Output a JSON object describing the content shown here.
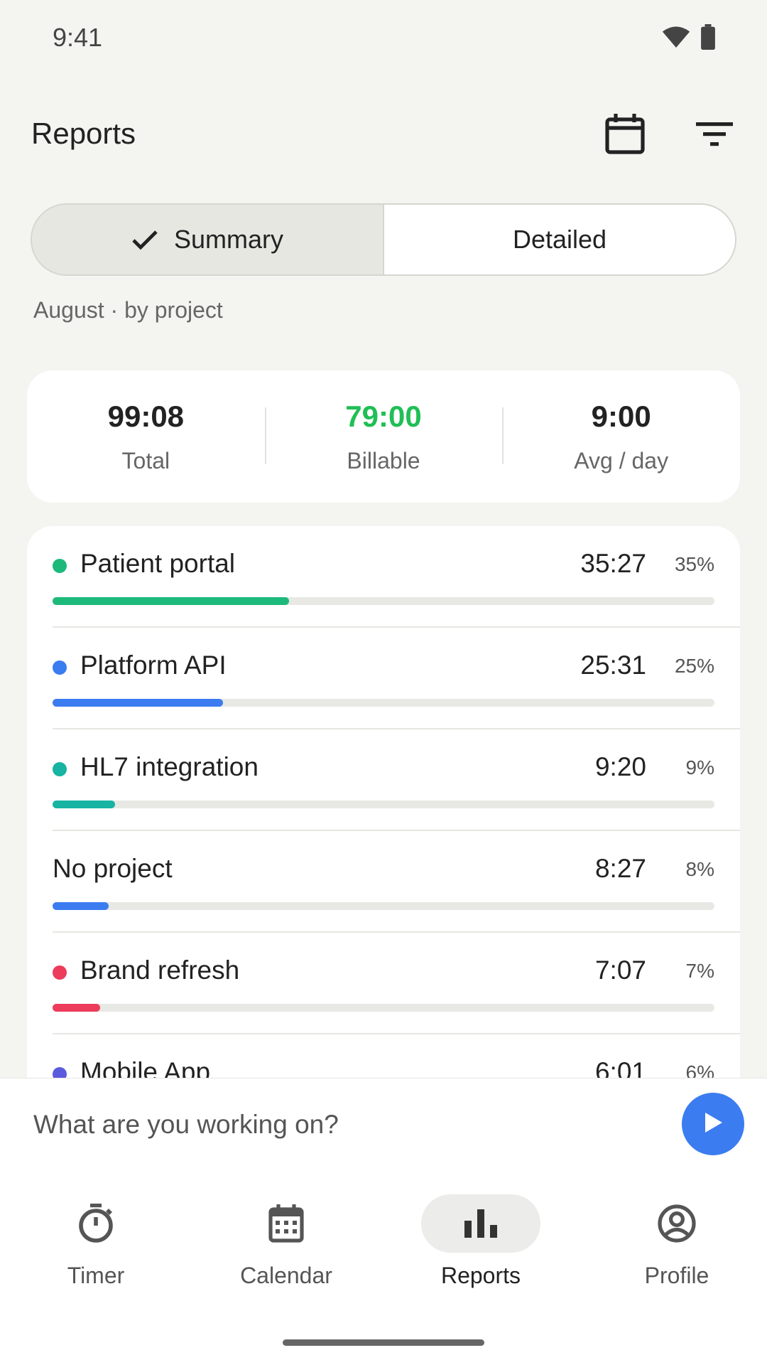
{
  "status": {
    "time": "9:41"
  },
  "header": {
    "title": "Reports"
  },
  "segmented": {
    "summary": "Summary",
    "detailed": "Detailed"
  },
  "subtitle": "August · by project",
  "totals": [
    {
      "value": "99:08",
      "label": "Total"
    },
    {
      "value": "79:00",
      "label": "Billable"
    },
    {
      "value": "9:00",
      "label": "Avg / day"
    }
  ],
  "projects": [
    {
      "name": "Patient portal",
      "duration": "35:27",
      "percent": "35%",
      "fraction": 0.357,
      "color": "#1db97a"
    },
    {
      "name": "Platform API",
      "duration": "25:31",
      "percent": "25%",
      "fraction": 0.257,
      "color": "#3b7cf0"
    },
    {
      "name": "HL7 integration",
      "duration": "9:20",
      "percent": "9%",
      "fraction": 0.094,
      "color": "#17b3a3"
    },
    {
      "name": "No project",
      "duration": "8:27",
      "percent": "8%",
      "fraction": 0.085,
      "color": "#3b7cf0",
      "nodot": true
    },
    {
      "name": "Brand refresh",
      "duration": "7:07",
      "percent": "7%",
      "fraction": 0.072,
      "color": "#ec3b5b"
    },
    {
      "name": "Mobile App",
      "duration": "6:01",
      "percent": "6%",
      "fraction": 0.06,
      "color": "#5b5bde"
    }
  ],
  "timer": {
    "prompt": "What are you working on?"
  },
  "nav": [
    {
      "label": "Timer",
      "icon": "stopwatch-icon"
    },
    {
      "label": "Calendar",
      "icon": "calendar-icon"
    },
    {
      "label": "Reports",
      "icon": "bar-chart-icon",
      "active": true
    },
    {
      "label": "Profile",
      "icon": "account-circle-icon"
    }
  ]
}
